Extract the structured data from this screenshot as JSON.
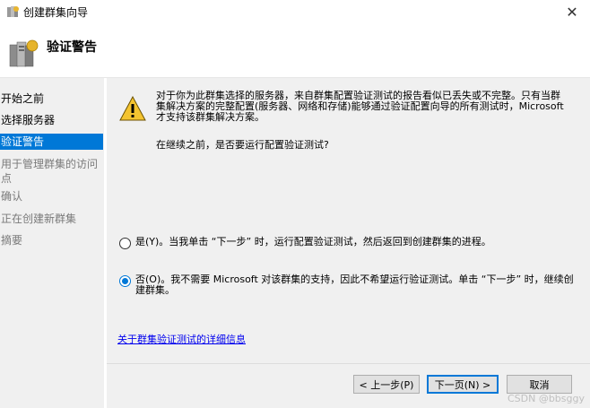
{
  "window": {
    "title": "创建群集向导",
    "close_glyph": "✕"
  },
  "header": {
    "page_title": "验证警告"
  },
  "sidebar": {
    "items": [
      {
        "label": "开始之前",
        "state": "normal"
      },
      {
        "label": "选择服务器",
        "state": "normal"
      },
      {
        "label": "验证警告",
        "state": "active"
      },
      {
        "label": "用于管理群集的访问点",
        "state": "disabled"
      },
      {
        "label": "确认",
        "state": "disabled"
      },
      {
        "label": "正在创建新群集",
        "state": "disabled"
      },
      {
        "label": "摘要",
        "state": "disabled"
      }
    ]
  },
  "main": {
    "warning_text": "对于你为此群集选择的服务器，来自群集配置验证测试的报告看似已丢失或不完整。只有当群集解决方案的完整配置(服务器、网络和存储)能够通过验证配置向导的所有测试时，Microsoft 才支持该群集解决方案。",
    "question": "在继续之前，是否要运行配置验证测试?",
    "options": [
      {
        "label": "是(Y)。当我单击 “下一步” 时，运行配置验证测试，然后返回到创建群集的进程。",
        "checked": false
      },
      {
        "label": "否(O)。我不需要 Microsoft 对该群集的支持，因此不希望运行验证测试。单击 “下一步” 时，继续创建群集。",
        "checked": true
      }
    ],
    "more_info_link": "关于群集验证测试的详细信息"
  },
  "footer": {
    "prev_label": "< 上一步(P)",
    "next_label": "下一页(N) >",
    "cancel_label": "取消"
  },
  "watermark": "CSDN @bbsggy",
  "colors": {
    "accent": "#0078d7",
    "link": "#0000ee",
    "panel_bg": "#f0f0f0"
  }
}
